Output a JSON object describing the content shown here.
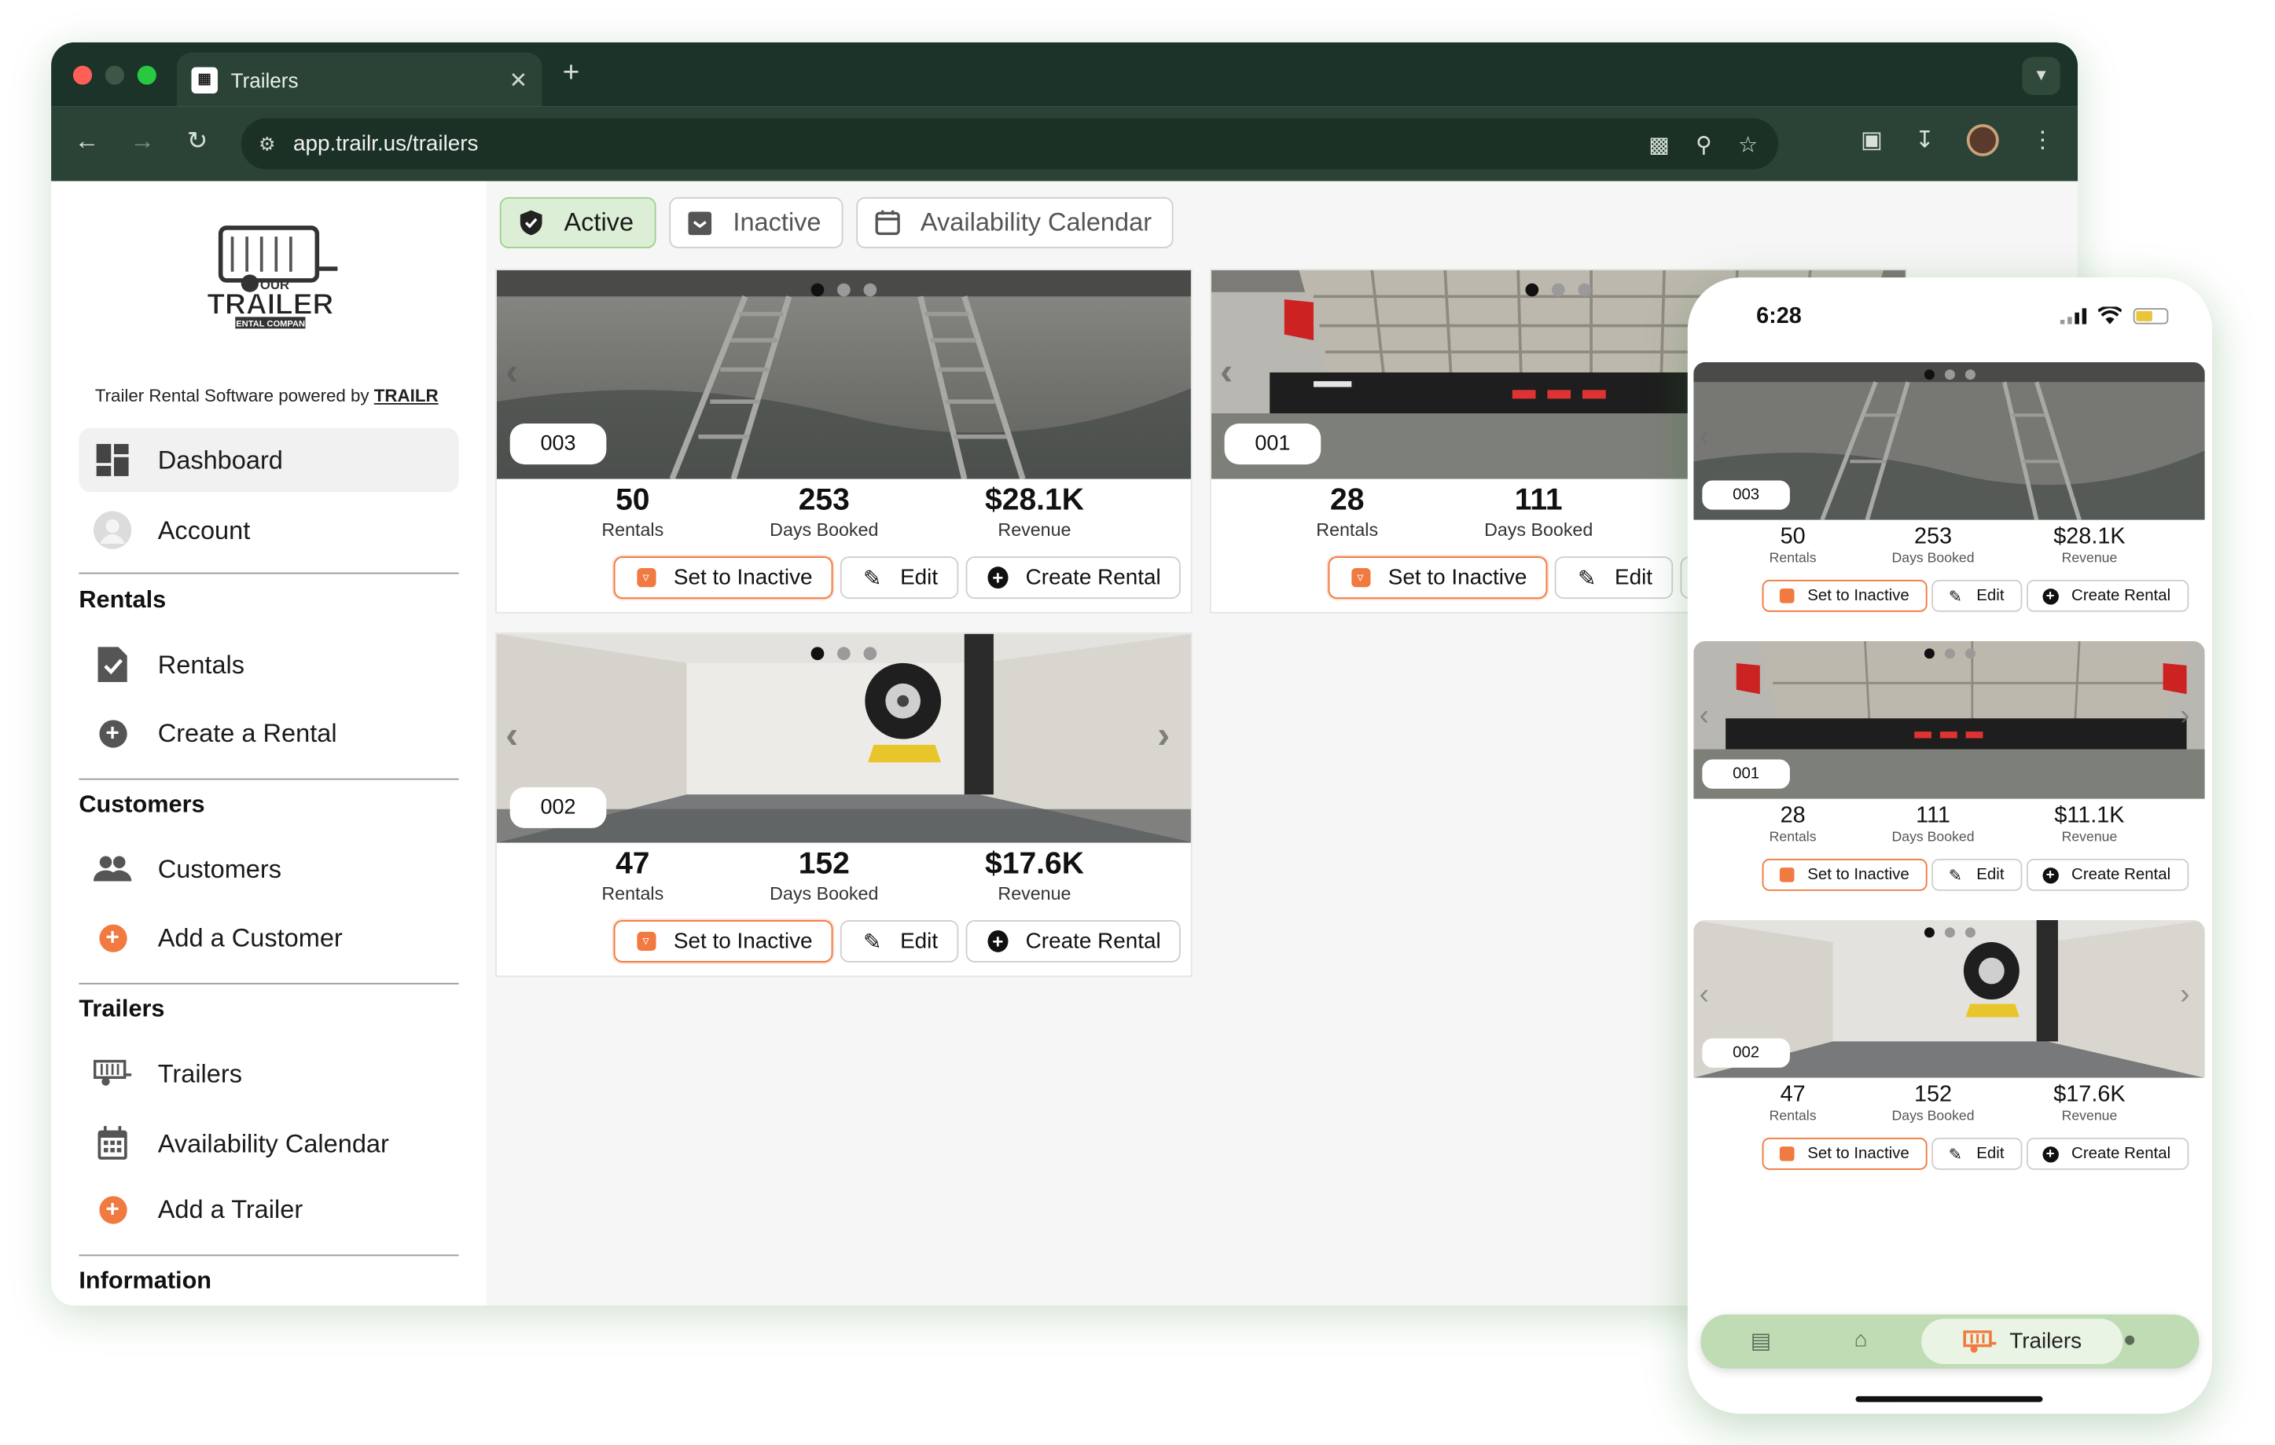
{
  "browser": {
    "tab_title": "Trailers",
    "url": "app.trailr.us/trailers",
    "traffic_lights": [
      "#ff5f57",
      "#3d5647",
      "#28c840"
    ]
  },
  "sidebar": {
    "logo": {
      "line1": "YOUR",
      "line2": "TRAILER",
      "line3": "RENTAL COMPANY"
    },
    "powered_prefix": "Trailer Rental Software powered by ",
    "powered_brand": "TRAILR",
    "dashboard": "Dashboard",
    "account": "Account",
    "rentals_header": "Rentals",
    "rentals": "Rentals",
    "create_rental": "Create a Rental",
    "customers_header": "Customers",
    "customers": "Customers",
    "add_customer": "Add a Customer",
    "trailers_header": "Trailers",
    "trailers": "Trailers",
    "availability": "Availability Calendar",
    "add_trailer": "Add a Trailer",
    "information_header": "Information"
  },
  "filters": {
    "active": "Active",
    "inactive": "Inactive",
    "calendar": "Availability Calendar"
  },
  "labels": {
    "rentals": "Rentals",
    "days_booked": "Days Booked",
    "revenue": "Revenue",
    "set_inactive": "Set to Inactive",
    "edit": "Edit",
    "create_rental": "Create Rental"
  },
  "trailers": [
    {
      "id": "003",
      "rentals": "50",
      "days": "253",
      "revenue": "$28.1K"
    },
    {
      "id": "001",
      "rentals": "28",
      "days": "111",
      "revenue": "$11.1K"
    },
    {
      "id": "002",
      "rentals": "47",
      "days": "152",
      "revenue": "$17.6K"
    }
  ],
  "phone": {
    "time": "6:28",
    "nav_selected": "Trailers"
  },
  "colors": {
    "accent_orange": "#f07a3f",
    "chrome_dark": "#1b3328",
    "active_green": "#dcefd6"
  }
}
